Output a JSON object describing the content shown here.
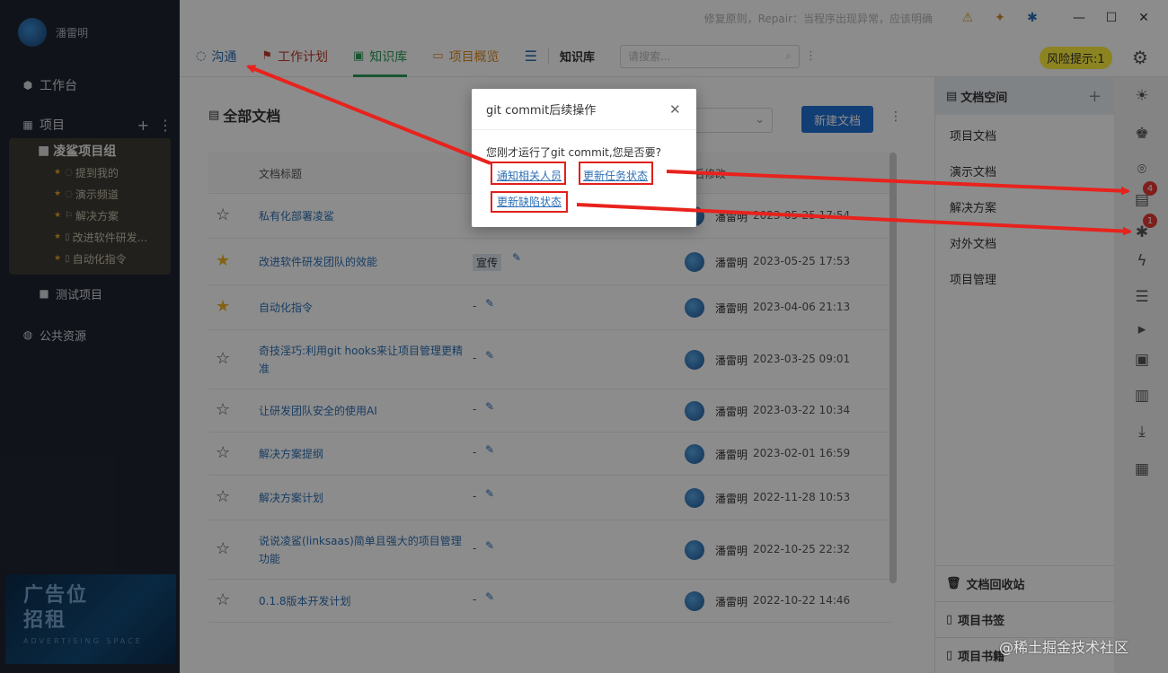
{
  "sidebar": {
    "username": "潘雷明",
    "workbench": "工作台",
    "projects_label": "项目",
    "group_name": "凌鲨项目组",
    "group_items": [
      "提到我的",
      "演示频道",
      "解决方案",
      "改进软件研发...",
      "自动化指令"
    ],
    "test_project": "测试项目",
    "public_resources": "公共资源",
    "ad": {
      "line1": "广告位",
      "line2": "招租",
      "line3": "ADVERTISING SPACE"
    }
  },
  "titlebar": {
    "notice": "修复原则，Repair：当程序出现异常，应该明确"
  },
  "tabs": [
    {
      "label": "沟通",
      "color": "#2d6fb5"
    },
    {
      "label": "工作计划",
      "color": "#c0392b"
    },
    {
      "label": "知识库",
      "color": "#2d9c5a"
    },
    {
      "label": "项目概览",
      "color": "#e08a1e"
    }
  ],
  "tabbar": {
    "kb_title": "知识库",
    "search_placeholder": "请搜索...",
    "risk": "风险提示:1"
  },
  "main": {
    "title": "全部文档",
    "new_button": "新建文档",
    "col_title": "文档标题",
    "col_modified": "后修改",
    "rows": [
      {
        "title": "私有化部署凌鲨",
        "tag": "",
        "starred": false,
        "user": "潘雷明",
        "time": "2023-05-25 17:54"
      },
      {
        "title": "改进软件研发团队的效能",
        "tag": "宣传",
        "starred": true,
        "user": "潘雷明",
        "time": "2023-05-25 17:53"
      },
      {
        "title": "自动化指令",
        "tag": "-",
        "starred": true,
        "user": "潘雷明",
        "time": "2023-04-06 21:13"
      },
      {
        "title": "奇技淫巧:利用git hooks来让项目管理更精准",
        "tag": "-",
        "starred": false,
        "user": "潘雷明",
        "time": "2023-03-25 09:01"
      },
      {
        "title": "让研发团队安全的使用AI",
        "tag": "-",
        "starred": false,
        "user": "潘雷明",
        "time": "2023-03-22 10:34"
      },
      {
        "title": "解决方案提纲",
        "tag": "-",
        "starred": false,
        "user": "潘雷明",
        "time": "2023-02-01 16:59"
      },
      {
        "title": "解决方案计划",
        "tag": "-",
        "starred": false,
        "user": "潘雷明",
        "time": "2022-11-28 10:53"
      },
      {
        "title": "说说凌鲨(linksaas)简单且强大的项目管理功能",
        "tag": "-",
        "starred": false,
        "user": "潘雷明",
        "time": "2022-10-25 22:32"
      },
      {
        "title": "0.1.8版本开发计划",
        "tag": "-",
        "starred": false,
        "user": "潘雷明",
        "time": "2022-10-22 14:46"
      }
    ]
  },
  "docpanel": {
    "head": "文档空间",
    "items": [
      "项目文档",
      "演示文档",
      "解决方案",
      "对外文档",
      "项目管理"
    ],
    "recycle": "文档回收站",
    "bookmark": "项目书签",
    "bookmark2": "项目书籍"
  },
  "badges": {
    "doc": "4",
    "bug": "1"
  },
  "modal": {
    "title": "git commit后续操作",
    "prompt": "您刚才运行了git commit,您是否要?",
    "link_notify": "通知相关人员",
    "link_task": "更新任务状态",
    "link_bug": "更新缺陷状态"
  },
  "watermark": "@稀土掘金技术社区"
}
